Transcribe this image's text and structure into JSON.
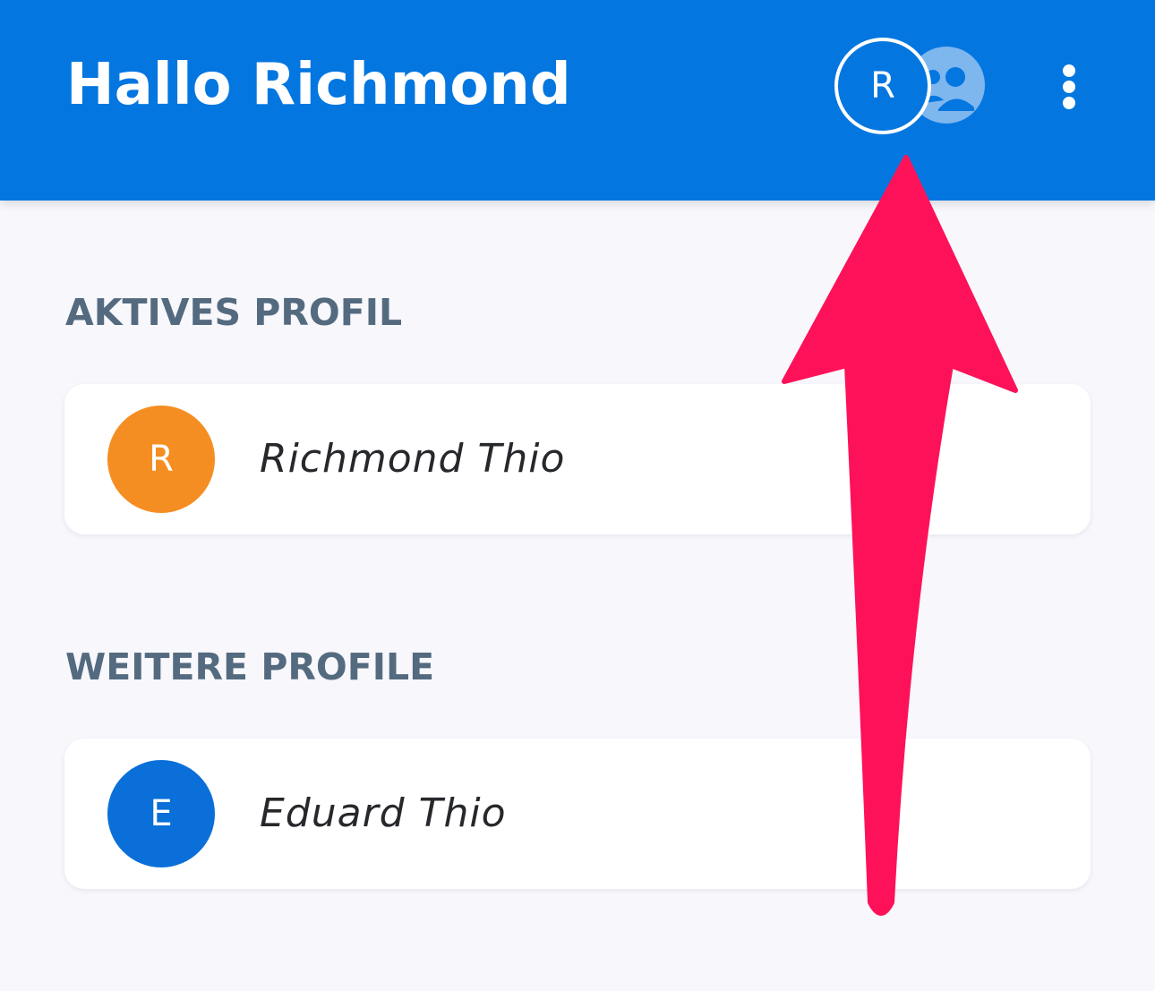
{
  "header": {
    "title": "Hallo Richmond",
    "active_avatar_initial": "R",
    "group_icon": "group-switch-icon",
    "menu_icon": "more-vert-icon"
  },
  "sections": {
    "active": {
      "label": "AKTIVES PROFIL",
      "profile": {
        "initial": "R",
        "name": "Richmond Thio",
        "color": "#f58e22"
      }
    },
    "others": {
      "label": "WEITERE PROFILE",
      "profiles": [
        {
          "initial": "E",
          "name": "Eduard Thio",
          "color": "#0a6fd8"
        }
      ]
    }
  },
  "colors": {
    "app_bar": "#0476e0",
    "background": "#f7f7fc",
    "section_label": "#546a7f",
    "annotation_arrow": "#fd1259"
  }
}
